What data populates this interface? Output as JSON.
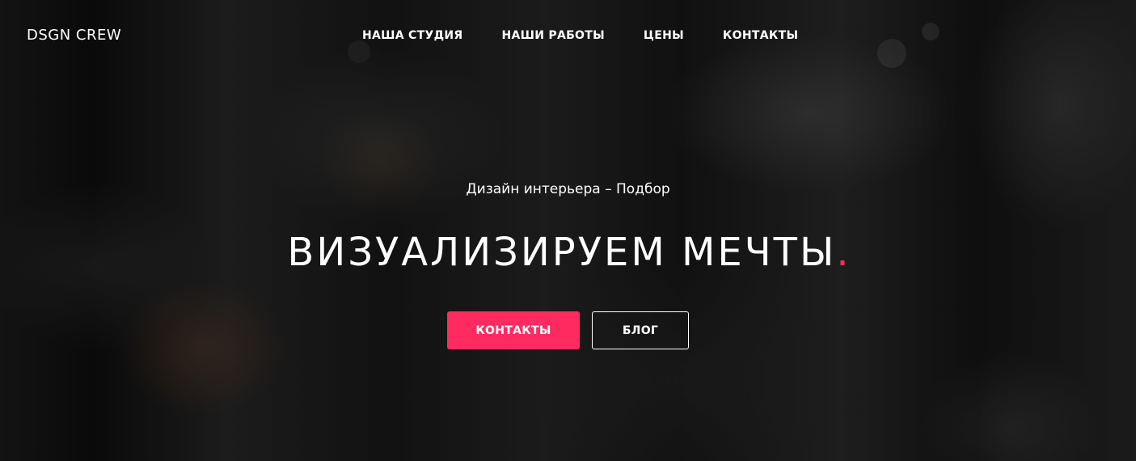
{
  "header": {
    "logo": "DSGN CREW",
    "nav": [
      {
        "label": "НАША СТУДИЯ"
      },
      {
        "label": "НАШИ РАБОТЫ"
      },
      {
        "label": "ЦЕНЫ"
      },
      {
        "label": "КОНТАКТЫ"
      }
    ]
  },
  "hero": {
    "subtitle": "Дизайн интерьера – Подбор",
    "headline": "ВИЗУАЛИЗИРУЕМ МЕЧТЫ",
    "headline_dot": ".",
    "primary_button": "КОНТАКТЫ",
    "secondary_button": "БЛОГ"
  },
  "colors": {
    "accent": "#ff2a5f",
    "text": "#ffffff",
    "overlay": "#141414"
  }
}
